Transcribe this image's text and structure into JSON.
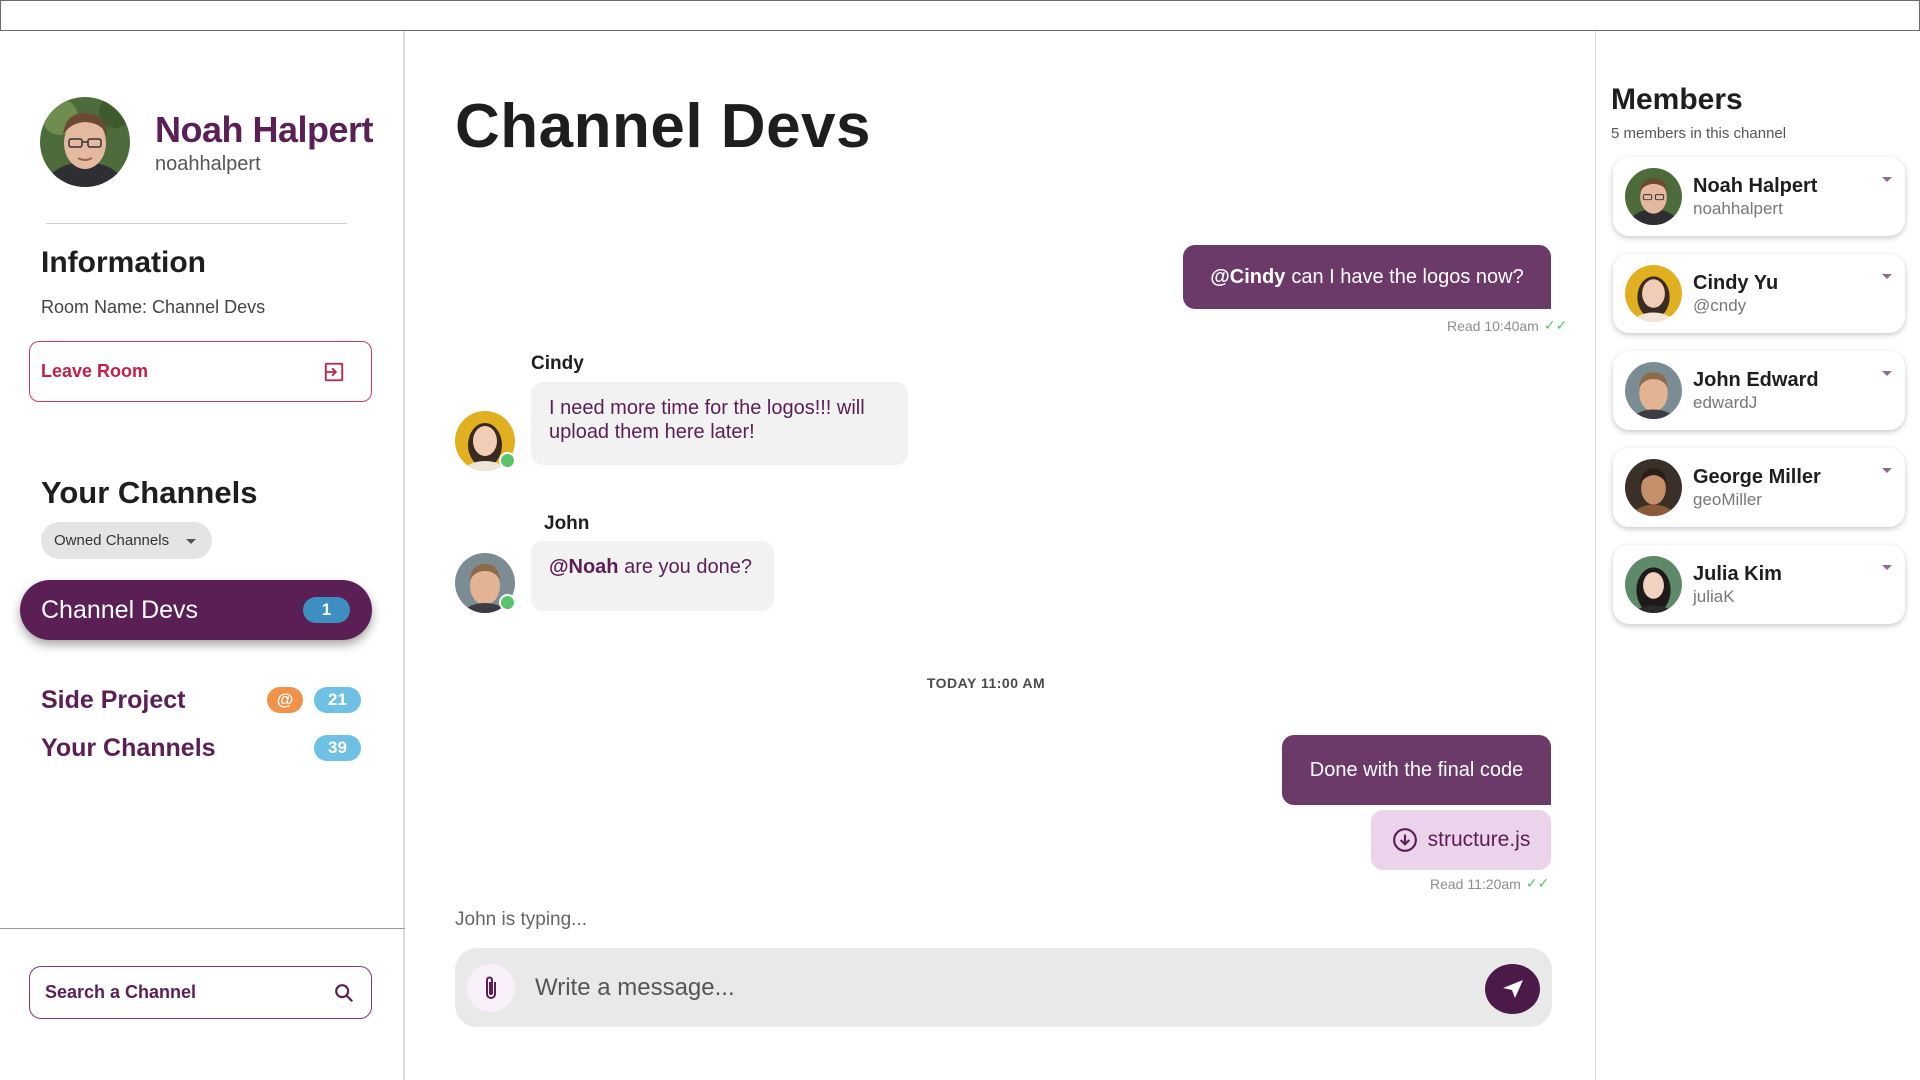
{
  "profile": {
    "name": "Noah Halpert",
    "handle": "noahhalpert"
  },
  "information": {
    "title": "Information",
    "room_name": "Room Name: Channel Devs",
    "leave_label": "Leave Room"
  },
  "channels": {
    "title": "Your Channels",
    "filter_label": "Owned Channels",
    "items": [
      {
        "label": "Channel Devs",
        "count": "1",
        "active": true
      },
      {
        "label": "Side Project",
        "count": "21",
        "mention": "@"
      },
      {
        "label": "Your Channels",
        "count": "39"
      }
    ]
  },
  "search": {
    "label": "Search a Channel"
  },
  "chat": {
    "title": "Channel Devs",
    "messages": [
      {
        "mention": "@Cindy",
        "text": "can I have the logos now?",
        "receipt": "Read 10:40am"
      },
      {
        "sender": "Cindy",
        "text": "I need more time for the logos!!! will upload them here later!"
      },
      {
        "sender": "John",
        "mention": "@Noah",
        "text": "are you done?"
      },
      {
        "text": "Done with the final code",
        "file": "structure.js",
        "receipt": "Read 11:20am"
      }
    ],
    "time_separator": "TODAY 11:00 AM",
    "typing": "John is typing...",
    "composer_placeholder": "Write a message..."
  },
  "members": {
    "title": "Members",
    "subtitle": "5 members in this channel",
    "list": [
      {
        "name": "Noah Halpert",
        "handle": "noahhalpert"
      },
      {
        "name": "Cindy Yu",
        "handle": "@cndy"
      },
      {
        "name": "John Edward",
        "handle": "edwardJ"
      },
      {
        "name": "George Miller",
        "handle": "geoMiller"
      },
      {
        "name": "Julia Kim",
        "handle": "juliaK"
      }
    ]
  },
  "colors": {
    "brand": "#5a1f55",
    "outgoing_bubble": "#6b3a68",
    "badge": "#4fa9d6",
    "mention_badge": "#f0924a",
    "danger": "#d23a5a",
    "online": "#58c46c"
  }
}
